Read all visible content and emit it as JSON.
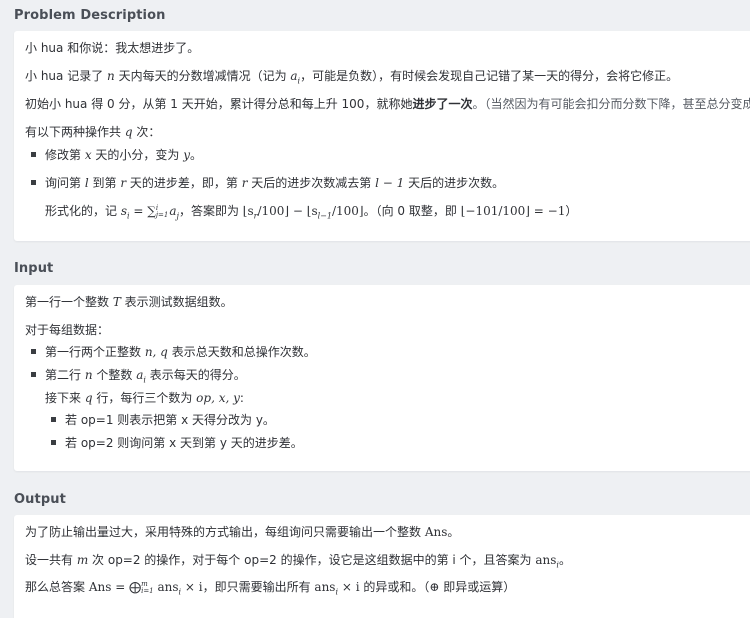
{
  "problem": {
    "heading": "Problem Description",
    "p1": "小 hua 和你说：我太想进步了。",
    "p2_a": "小 hua 记录了 ",
    "p2_n": "n",
    "p2_b": " 天内每天的分数增减情况（记为 ",
    "p2_ai": "a",
    "p2_ai_sub": "i",
    "p2_c": "，可能是负数），有时候会发现自己记错了某一天的得分，会将它修正。",
    "p3_a": "初始小 hua 得 0 分，从第 1 天开始，累计得分总和每上升 100，就称她",
    "p3_bold": "进步了一次",
    "p3_b": "。（当然因为有可能会扣分而分数下降，甚至总分变成负数）",
    "p4_a": "有以下两种操作共 ",
    "p4_q": "q",
    "p4_b": " 次：",
    "b1_a": "修改第 ",
    "b1_x": "x",
    "b1_b": " 天的小分，变为 ",
    "b1_y": "y",
    "b1_c": "。",
    "b2_a": "询问第 ",
    "b2_l": "l",
    "b2_b": " 到第 ",
    "b2_r": "r",
    "b2_c": " 天的进步差，即，第 ",
    "b2_r2": "r",
    "b2_d": " 天后的进步次数减去第 ",
    "b2_l1": "l − 1",
    "b2_e": " 天后的进步次数。",
    "f_a": "形式化的，记 ",
    "f_formula1": "s",
    "f_formula1_sub": "i",
    "f_eq": " = ∑",
    "f_sum_sub": "j=1",
    "f_sum_sup": "i",
    "f_aj": "a",
    "f_aj_sub": "j",
    "f_b": "，答案即为 ",
    "f_floor1": "⌊s",
    "f_floor1_sub": "r",
    "f_floor1_end": "/100⌋ − ⌊s",
    "f_floor2_sub": "l−1",
    "f_floor2_end": "/100⌋",
    "f_c": "。（向 0 取整，即 ",
    "f_ex": "⌊−101/100⌋ = −1",
    "f_d": "）"
  },
  "input": {
    "heading": "Input",
    "l1_a": "第一行一个整数 ",
    "l1_T": "T",
    "l1_b": " 表示测试数据组数。",
    "l2": "对于每组数据：",
    "b1_a": "第一行两个正整数 ",
    "b1_nq": "n, q",
    "b1_b": " 表示总天数和总操作次数。",
    "b2_a": "第二行 ",
    "b2_n": "n",
    "b2_b": " 个整数 ",
    "b2_ai": "a",
    "b2_ai_sub": "i",
    "b2_c": " 表示每天的得分。",
    "l3_a": "接下来 ",
    "l3_q": "q",
    "l3_b": " 行，每行三个数为 ",
    "l3_vars": "op, x, y",
    "l3_c": ":",
    "s1": "若 op=1 则表示把第 x 天得分改为 y。",
    "s2": "若 op=2 则询问第 x 天到第 y 天的进步差。"
  },
  "output": {
    "heading": "Output",
    "l1_a": "为了防止输出量过大，采用特殊的方式输出，每组询问只需要输出一个整数 ",
    "l1_ans": "Ans",
    "l1_b": "。",
    "l2_a": "设一共有 ",
    "l2_m": "m",
    "l2_b": " 次 op=2 的操作，对于每个 op=2 的操作，设它是这组数据中的第 i 个，且答案为 ",
    "l2_ans": "ans",
    "l2_ans_sub": "i",
    "l2_c": "。",
    "l3_a": "那么总答案 ",
    "l3_f1": "Ans = ⨁",
    "l3_f1_sup": "m",
    "l3_f1_sub": "i=1",
    "l3_f2": " ans",
    "l3_f2_sub": "i",
    "l3_f3": " × i",
    "l3_b": "，即只需要输出所有 ",
    "l3_ans": "ans",
    "l3_ans_sub": "i",
    "l3_x": " × i",
    "l3_c": " 的异或和。（",
    "l3_xor": "⊕",
    "l3_d": " 即异或运算）"
  }
}
